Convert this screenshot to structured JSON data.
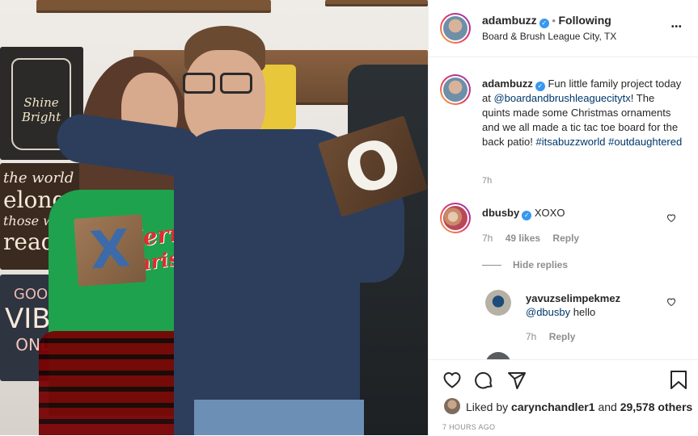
{
  "photo": {
    "signs": {
      "shine": "Shine Bright",
      "world": [
        "the world",
        "elongs",
        "those wh",
        "read"
      ],
      "vibes": [
        "GOOD",
        "VIBE",
        "ONLY"
      ],
      "shirt": [
        "Merry",
        "Christm"
      ]
    },
    "tiles": {
      "x": "X",
      "o": "O"
    }
  },
  "post": {
    "author": "adambuzz",
    "follow_label": "Following",
    "location": "Board & Brush League City, TX",
    "more_label": "•••"
  },
  "caption": {
    "author": "adambuzz",
    "text_1": "Fun little family project today at",
    "mention": "@boardandbrushleaguecitytx",
    "text_2": "! The quints made some Christmas ornaments and we all made a tic tac toe board for the back patio!",
    "hashtag_1": "#itsabuzzworld",
    "hashtag_2": "#outdaughtered",
    "time": "7h"
  },
  "comments": [
    {
      "author": "dbusby",
      "text": "XOXO",
      "time": "7h",
      "likes": "49 likes",
      "reply_label": "Reply",
      "hide_replies_label": "Hide replies"
    }
  ],
  "replies": [
    {
      "author": "yavuzselimpekmez",
      "mention": "@dbusby",
      "text": "hello",
      "time": "7h",
      "reply_label": "Reply"
    }
  ],
  "footer": {
    "liked_by_prefix": "Liked by",
    "liked_by_user": "carynchandler1",
    "liked_by_and": "and",
    "likes_count": "29,578 others",
    "timestamp": "7 HOURS AGO"
  },
  "colors": {
    "accent_link": "#00376b",
    "verified": "#3897f0",
    "muted": "#8e8e8e"
  }
}
